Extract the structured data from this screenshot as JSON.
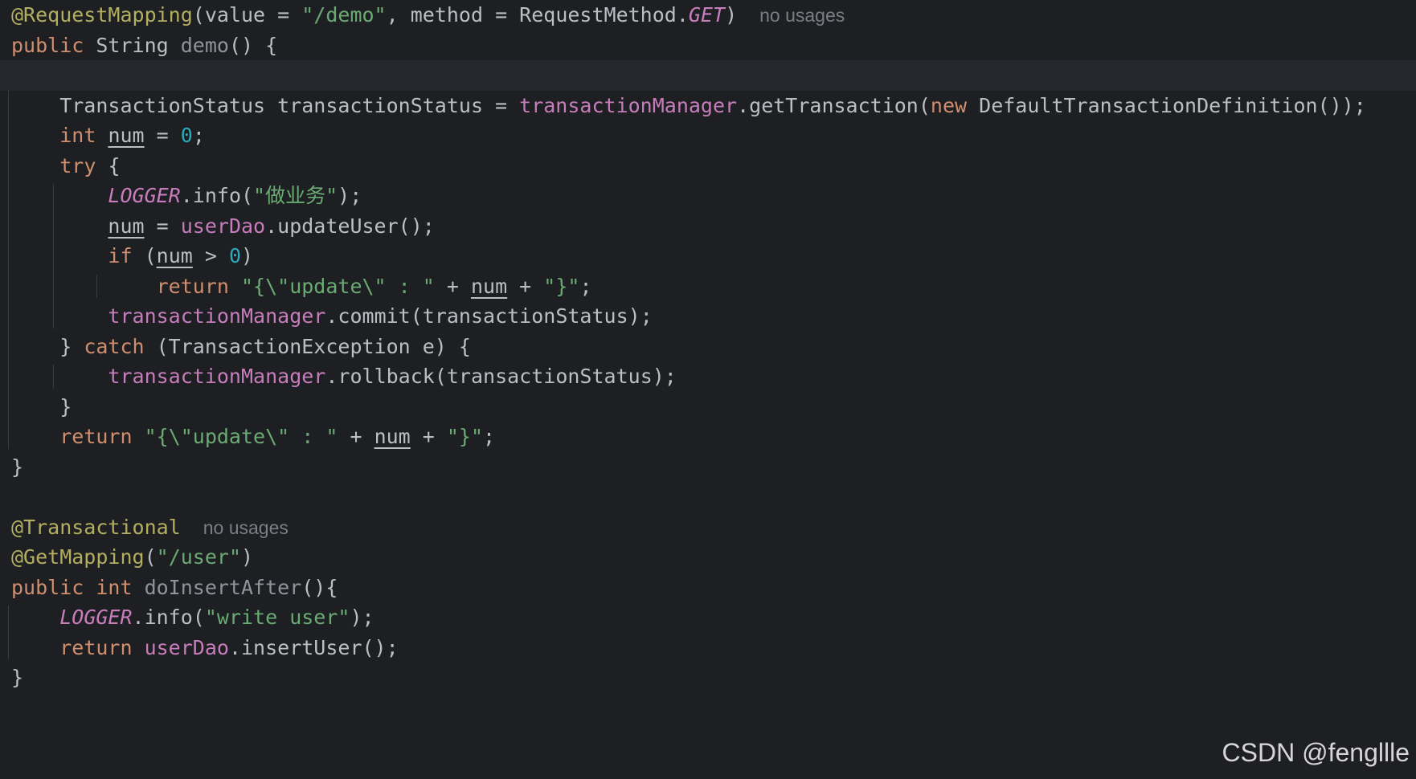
{
  "editor": {
    "theme_colors": {
      "background": "#1e1f22",
      "keyword": "#cf8e6d",
      "string": "#6aab73",
      "number": "#2aacb8",
      "annotation": "#b3ae60",
      "field": "#c77dbb",
      "text": "#bcbec4",
      "hint": "#7a7e85"
    },
    "lines": [
      {
        "tokens": [
          {
            "text": "@RequestMapping",
            "style": "ann"
          },
          {
            "text": "(value = ",
            "style": "plain"
          },
          {
            "text": "\"/demo\"",
            "style": "str"
          },
          {
            "text": ", method = RequestMethod.",
            "style": "plain"
          },
          {
            "text": "GET",
            "style": "static"
          },
          {
            "text": ")",
            "style": "plain"
          },
          {
            "text": "no usages",
            "style": "hint"
          }
        ]
      },
      {
        "tokens": [
          {
            "text": "public ",
            "style": "kw"
          },
          {
            "text": "String ",
            "style": "plain"
          },
          {
            "text": "demo",
            "style": "fn-decl"
          },
          {
            "text": "() {",
            "style": "plain"
          }
        ]
      },
      {
        "current": true,
        "tokens": []
      },
      {
        "tokens": [
          {
            "text": "    TransactionStatus transactionStatus = ",
            "style": "plain"
          },
          {
            "text": "transactionManager",
            "style": "field"
          },
          {
            "text": ".getTransaction(",
            "style": "plain"
          },
          {
            "text": "new ",
            "style": "kw"
          },
          {
            "text": "DefaultTransactionDefinition());",
            "style": "plain"
          }
        ]
      },
      {
        "tokens": [
          {
            "text": "    ",
            "style": "plain"
          },
          {
            "text": "int ",
            "style": "kw"
          },
          {
            "text": "num",
            "style": "var-u"
          },
          {
            "text": " = ",
            "style": "plain"
          },
          {
            "text": "0",
            "style": "num"
          },
          {
            "text": ";",
            "style": "plain"
          }
        ]
      },
      {
        "tokens": [
          {
            "text": "    ",
            "style": "plain"
          },
          {
            "text": "try ",
            "style": "kw"
          },
          {
            "text": "{",
            "style": "plain"
          }
        ]
      },
      {
        "tokens": [
          {
            "text": "        ",
            "style": "plain"
          },
          {
            "text": "LOGGER",
            "style": "static"
          },
          {
            "text": ".info(",
            "style": "plain"
          },
          {
            "text": "\"做业务\"",
            "style": "str"
          },
          {
            "text": ");",
            "style": "plain"
          }
        ]
      },
      {
        "tokens": [
          {
            "text": "        ",
            "style": "plain"
          },
          {
            "text": "num",
            "style": "var-u"
          },
          {
            "text": " = ",
            "style": "plain"
          },
          {
            "text": "userDao",
            "style": "field"
          },
          {
            "text": ".updateUser();",
            "style": "plain"
          }
        ]
      },
      {
        "tokens": [
          {
            "text": "        ",
            "style": "plain"
          },
          {
            "text": "if ",
            "style": "kw"
          },
          {
            "text": "(",
            "style": "plain"
          },
          {
            "text": "num",
            "style": "var-u"
          },
          {
            "text": " > ",
            "style": "plain"
          },
          {
            "text": "0",
            "style": "num"
          },
          {
            "text": ")",
            "style": "plain"
          }
        ]
      },
      {
        "tokens": [
          {
            "text": "            ",
            "style": "plain"
          },
          {
            "text": "return ",
            "style": "kw"
          },
          {
            "text": "\"{\\\"update\\\" : \"",
            "style": "str"
          },
          {
            "text": " + ",
            "style": "plain"
          },
          {
            "text": "num",
            "style": "var-u"
          },
          {
            "text": " + ",
            "style": "plain"
          },
          {
            "text": "\"}\"",
            "style": "str"
          },
          {
            "text": ";",
            "style": "plain"
          }
        ]
      },
      {
        "tokens": [
          {
            "text": "        ",
            "style": "plain"
          },
          {
            "text": "transactionManager",
            "style": "field"
          },
          {
            "text": ".commit(transactionStatus);",
            "style": "plain"
          }
        ]
      },
      {
        "tokens": [
          {
            "text": "    } ",
            "style": "plain"
          },
          {
            "text": "catch ",
            "style": "kw"
          },
          {
            "text": "(TransactionException e) {",
            "style": "plain"
          }
        ]
      },
      {
        "tokens": [
          {
            "text": "        ",
            "style": "plain"
          },
          {
            "text": "transactionManager",
            "style": "field"
          },
          {
            "text": ".rollback(transactionStatus);",
            "style": "plain"
          }
        ]
      },
      {
        "tokens": [
          {
            "text": "    }",
            "style": "plain"
          }
        ]
      },
      {
        "tokens": [
          {
            "text": "    ",
            "style": "plain"
          },
          {
            "text": "return ",
            "style": "kw"
          },
          {
            "text": "\"{\\\"update\\\" : \"",
            "style": "str"
          },
          {
            "text": " + ",
            "style": "plain"
          },
          {
            "text": "num",
            "style": "var-u"
          },
          {
            "text": " + ",
            "style": "plain"
          },
          {
            "text": "\"}\"",
            "style": "str"
          },
          {
            "text": ";",
            "style": "plain"
          }
        ]
      },
      {
        "tokens": [
          {
            "text": "}",
            "style": "plain"
          }
        ]
      },
      {
        "tokens": []
      },
      {
        "tokens": [
          {
            "text": "@Transactional",
            "style": "ann"
          },
          {
            "text": "no usages",
            "style": "hint"
          }
        ]
      },
      {
        "tokens": [
          {
            "text": "@GetMapping",
            "style": "ann"
          },
          {
            "text": "(",
            "style": "plain"
          },
          {
            "text": "\"/user\"",
            "style": "str"
          },
          {
            "text": ")",
            "style": "plain"
          }
        ]
      },
      {
        "tokens": [
          {
            "text": "public ",
            "style": "kw"
          },
          {
            "text": "int ",
            "style": "kw"
          },
          {
            "text": "doInsertAfter",
            "style": "fn-decl"
          },
          {
            "text": "(){",
            "style": "plain"
          }
        ]
      },
      {
        "tokens": [
          {
            "text": "    ",
            "style": "plain"
          },
          {
            "text": "LOGGER",
            "style": "static"
          },
          {
            "text": ".info(",
            "style": "plain"
          },
          {
            "text": "\"write user\"",
            "style": "str"
          },
          {
            "text": ");",
            "style": "plain"
          }
        ]
      },
      {
        "tokens": [
          {
            "text": "    ",
            "style": "plain"
          },
          {
            "text": "return ",
            "style": "kw"
          },
          {
            "text": "userDao",
            "style": "field"
          },
          {
            "text": ".insertUser();",
            "style": "plain"
          }
        ]
      },
      {
        "tokens": [
          {
            "text": "}",
            "style": "plain"
          }
        ]
      }
    ]
  },
  "watermark": "CSDN @fengllle"
}
